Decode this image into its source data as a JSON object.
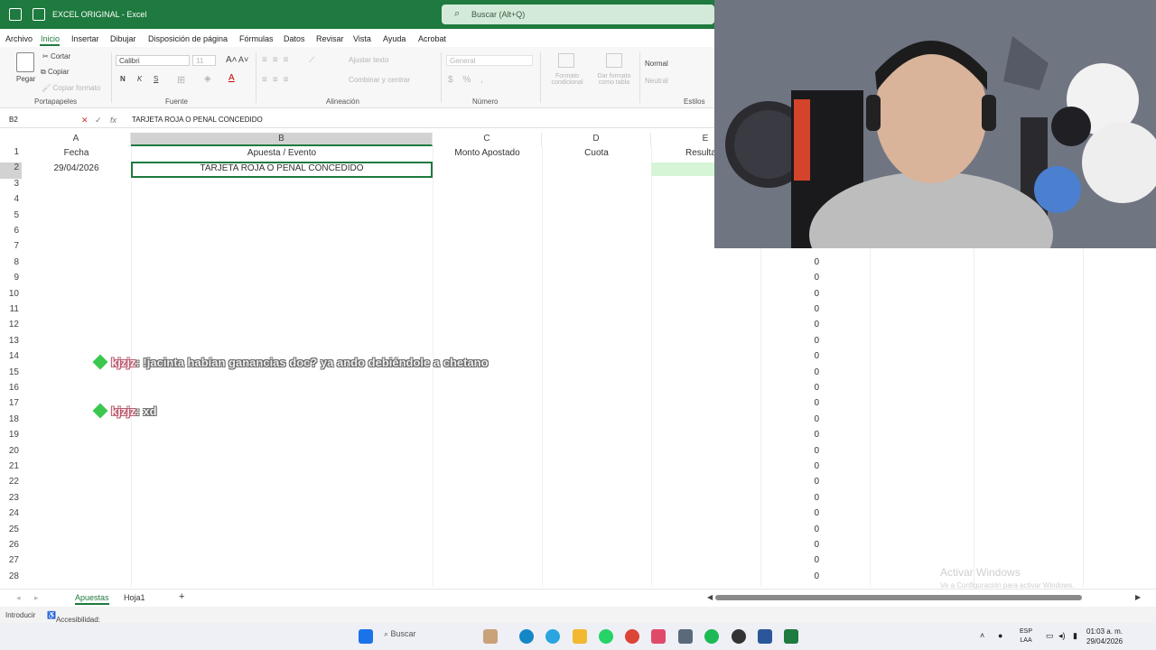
{
  "titlebar": {
    "title": "EXCEL ORIGINAL  -  Excel",
    "search_placeholder": "Buscar (Alt+Q)"
  },
  "menu": {
    "items": [
      "Archivo",
      "Inicio",
      "Insertar",
      "Dibujar",
      "Disposición de página",
      "Fórmulas",
      "Datos",
      "Revisar",
      "Vista",
      "Ayuda",
      "Acrobat"
    ],
    "active": "Inicio"
  },
  "ribbon": {
    "cut": "Cortar",
    "copy": "Copiar",
    "format_painter": "Copiar formato",
    "paste": "Pegar",
    "font_name": "Calibri",
    "font_size": "11",
    "bold": "N",
    "italic": "K",
    "underline": "S",
    "wrap_text": "Ajustar texto",
    "merge": "Combinar y centrar",
    "number_format": "General",
    "conditional": "Formato condicional",
    "as_table": "Dar formato como tabla",
    "style_normal": "Normal",
    "style_neutral": "Neutral",
    "groups": {
      "clipboard": "Portapapeles",
      "font": "Fuente",
      "alignment": "Alineación",
      "number": "Número",
      "styles": "Estilos"
    }
  },
  "formula_bar": {
    "name_box": "B2",
    "fx": "fx",
    "content": "TARJETA ROJA O PENAL CONCEDIDO"
  },
  "sheet": {
    "columns": [
      "A",
      "B",
      "C",
      "D",
      "E"
    ],
    "headers": {
      "A": "Fecha",
      "B": "Apuesta / Evento",
      "C": "Monto Apostado",
      "D": "Cuota",
      "E": "Resultado"
    },
    "row2": {
      "A": "29/04/2026",
      "B": "TARJETA ROJA O PENAL CONCEDIDO"
    },
    "row_numbers": [
      "1",
      "2",
      "3",
      "4",
      "5",
      "6",
      "7",
      "8",
      "9",
      "10",
      "11",
      "12",
      "13",
      "14",
      "15",
      "16",
      "17",
      "18",
      "19",
      "20",
      "21",
      "22",
      "23",
      "24",
      "25",
      "26",
      "27",
      "28"
    ],
    "zeros": [
      "0",
      "0",
      "0",
      "0",
      "0",
      "0",
      "0",
      "0",
      "0",
      "0",
      "0",
      "0",
      "0",
      "0",
      "0",
      "0",
      "0",
      "0",
      "0",
      "0",
      "0",
      "0"
    ]
  },
  "chat": [
    {
      "user": "kjzjz",
      "message": "!jacinta habían ganancias doc? ya ando debiéndole a chetano"
    },
    {
      "user": "kjzjz",
      "message": "xd"
    }
  ],
  "watermark": {
    "line1": "Activar Windows",
    "line2": "Ve a Configuración para activar Windows."
  },
  "tabs": {
    "sheets": [
      "Apuestas",
      "Hoja1"
    ],
    "active": "Apuestas",
    "add": "+"
  },
  "status": {
    "mode": "Introducir",
    "accessibility": "Accesibilidad: todo correcto"
  },
  "taskbar": {
    "search": "Buscar",
    "lang": "ESP",
    "lang2": "LAA",
    "time": "01:03 a. m.",
    "date": "29/04/2026"
  },
  "colors": {
    "excel_green": "#1e7a3e",
    "taskbar": "#eef0f6"
  }
}
